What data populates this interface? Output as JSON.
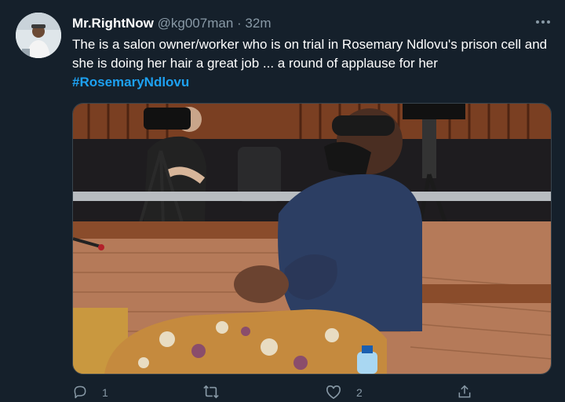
{
  "author": {
    "display_name": "Mr.RightNow",
    "handle": "@kg007man",
    "separator": "·",
    "time": "32m"
  },
  "tweet": {
    "text": "The is a salon owner/worker who is on trial in Rosemary Ndlovu's prison cell and she is doing her hair a great job ... a round of applause for her",
    "hashtag": "#RosemaryNdlovu"
  },
  "actions": {
    "reply_count": "1",
    "retweet_count": "",
    "like_count": "2"
  },
  "icons": {
    "more": "more-options-icon",
    "reply": "reply-icon",
    "retweet": "retweet-icon",
    "like": "heart-icon",
    "share": "share-icon"
  },
  "colors": {
    "background": "#15202b",
    "text": "#ffffff",
    "muted": "#8899a6",
    "link": "#1da1f2"
  }
}
